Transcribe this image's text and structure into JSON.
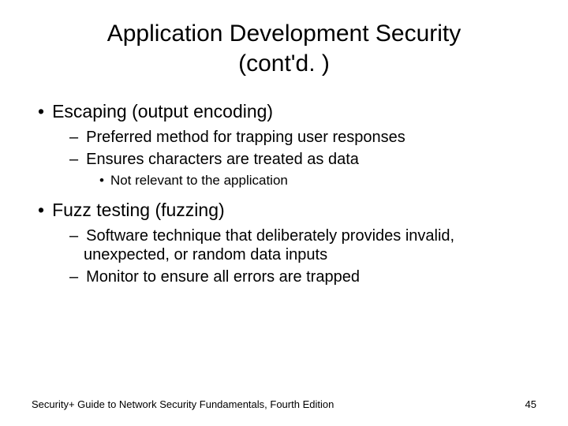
{
  "title_line1": "Application Development Security",
  "title_line2": "(cont'd. )",
  "bullets": {
    "b1": "Escaping (output encoding)",
    "b1_1": "Preferred method for trapping user responses",
    "b1_2": "Ensures characters are treated as data",
    "b1_2_1": "Not relevant to the application",
    "b2": "Fuzz testing (fuzzing)",
    "b2_1": "Software technique that deliberately provides invalid, unexpected, or random data inputs",
    "b2_2": "Monitor to ensure all errors are trapped"
  },
  "footer": {
    "left": "Security+ Guide to Network Security Fundamentals, Fourth Edition",
    "right": "45"
  }
}
